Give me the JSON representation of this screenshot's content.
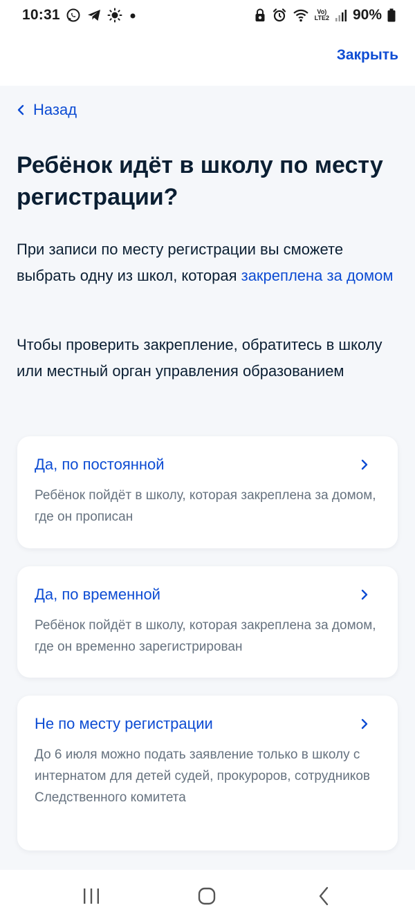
{
  "status_bar": {
    "time": "10:31",
    "lte_top": "Vo)",
    "lte_bottom": "LTE2",
    "battery": "90%",
    "icons": [
      "whatsapp-icon",
      "telegram-icon",
      "sun-icon",
      "dot-icon",
      "lock-icon",
      "alarm-icon",
      "wifi-icon",
      "signal-icon",
      "battery-icon"
    ]
  },
  "header": {
    "close_label": "Закрыть"
  },
  "nav": {
    "back_label": "Назад"
  },
  "main": {
    "title": "Ребёнок идёт в школу по месту регистрации?",
    "paragraph1_text": "При записи по месту регистрации вы сможете выбрать одну из школ, которая ",
    "paragraph1_link": "закреплена за домом",
    "paragraph2": "Чтобы проверить закрепление, обратитесь в школу или местный орган управления образованием"
  },
  "options": [
    {
      "title": "Да, по постоянной",
      "description": "Ребёнок пойдёт в школу, которая закреплена за домом, где он прописан"
    },
    {
      "title": "Да, по временной",
      "description": "Ребёнок пойдёт в школу, которая закреплена за домом, где он временно зарегистрирован"
    },
    {
      "title": "Не по месту регистрации",
      "description": "До 6 июля можно подать заявление только в школу с интернатом для детей судей, прокуроров, сотрудников Следственного комитета"
    }
  ],
  "system_nav": {
    "icons": [
      "recents-icon",
      "home-icon",
      "back-icon"
    ]
  },
  "colors": {
    "accent": "#0d4cd3",
    "text_primary": "#0b1f33",
    "text_secondary": "#66727f",
    "background": "#f5f7fa",
    "card": "#ffffff"
  }
}
